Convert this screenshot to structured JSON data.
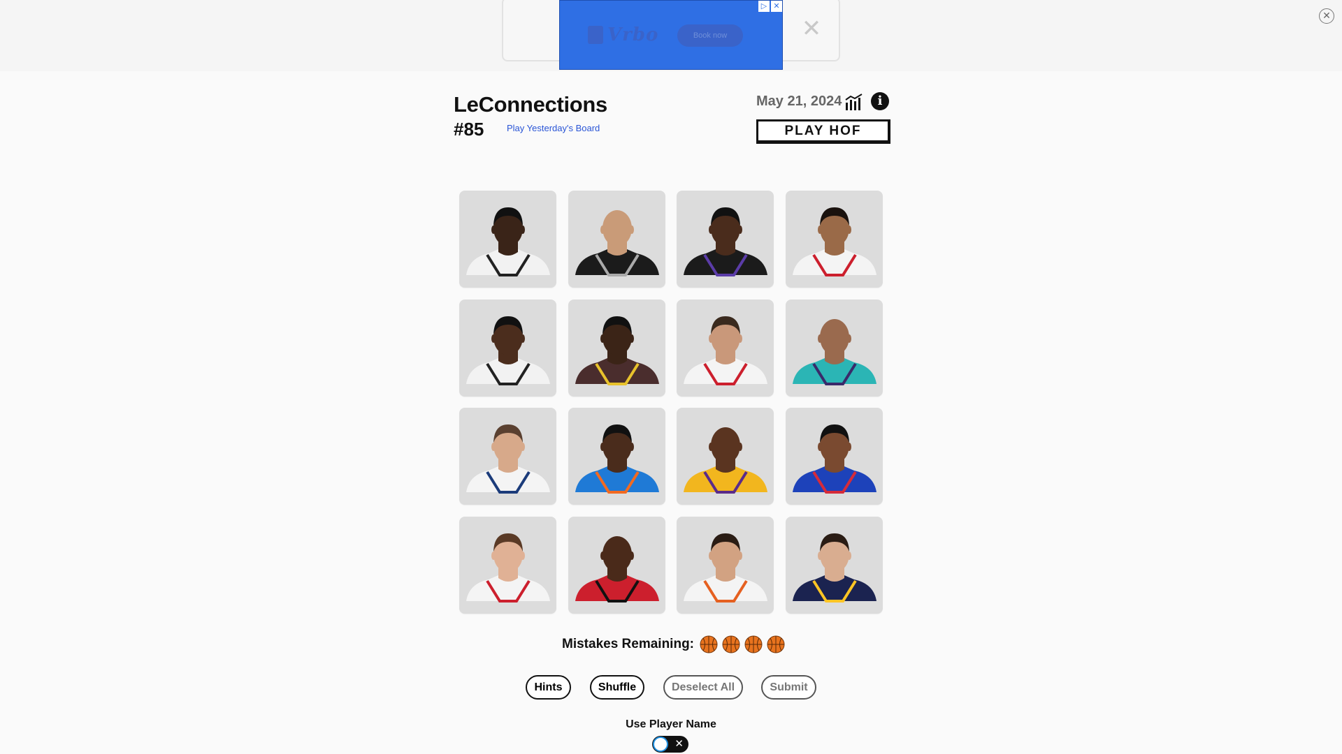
{
  "ad": {
    "brand": "Vrbo",
    "cta": "Book now",
    "adchoices_icon": "adchoices-icon",
    "close_glyph": "✕"
  },
  "page_close_glyph": "✕",
  "header": {
    "title": "LeConnections",
    "puzzle_number": "#85",
    "yesterday_link": "Play Yesterday's Board",
    "date": "May 21, 2024",
    "stats_icon": "bar-chart-icon",
    "info_icon": "info-icon",
    "info_glyph": "i",
    "hof_button": "PLAY HOF"
  },
  "grid": {
    "tiles": [
      {
        "icon": "player-portrait",
        "skin": "#3a2418",
        "hair": "#111",
        "jersey": "#f2f2f2",
        "trim": "#222"
      },
      {
        "icon": "player-portrait",
        "skin": "#c99b78",
        "hair": "none",
        "jersey": "#1b1b1b",
        "trim": "#aaa"
      },
      {
        "icon": "player-portrait",
        "skin": "#4a2c1c",
        "hair": "#111",
        "jersey": "#1b1b1b",
        "trim": "#5b3ca8"
      },
      {
        "icon": "player-portrait",
        "skin": "#9a6a48",
        "hair": "#1a120e",
        "jersey": "#f4f4f4",
        "trim": "#cc1f2d"
      },
      {
        "icon": "player-portrait",
        "skin": "#4b2d1d",
        "hair": "#111",
        "jersey": "#f2f2f2",
        "trim": "#222"
      },
      {
        "icon": "player-portrait",
        "skin": "#3b2417",
        "hair": "#111",
        "jersey": "#4a2d2d",
        "trim": "#e8c22c"
      },
      {
        "icon": "player-portrait",
        "skin": "#c9987a",
        "hair": "#3a2a1e",
        "jersey": "#f4f4f4",
        "trim": "#cc1f2d"
      },
      {
        "icon": "player-portrait",
        "skin": "#9a6a4e",
        "hair": "none",
        "jersey": "#2bb5b5",
        "trim": "#3a2a6a"
      },
      {
        "icon": "player-portrait",
        "skin": "#d7a98a",
        "hair": "#5a4030",
        "jersey": "#f4f4f4",
        "trim": "#1b3b7a"
      },
      {
        "icon": "player-portrait",
        "skin": "#4a2c1c",
        "hair": "#111",
        "jersey": "#1f7ad6",
        "trim": "#f26a21"
      },
      {
        "icon": "player-portrait",
        "skin": "#5a3420",
        "hair": "none",
        "jersey": "#f2b61e",
        "trim": "#5a2b8a"
      },
      {
        "icon": "player-portrait",
        "skin": "#7a4a30",
        "hair": "#111",
        "jersey": "#1d42ba",
        "trim": "#d62b3a"
      },
      {
        "icon": "player-portrait",
        "skin": "#e0b195",
        "hair": "#5a3a26",
        "jersey": "#f4f4f4",
        "trim": "#cc1f2d"
      },
      {
        "icon": "player-portrait",
        "skin": "#4a2a1a",
        "hair": "none",
        "jersey": "#cc1f2d",
        "trim": "#111"
      },
      {
        "icon": "player-portrait",
        "skin": "#d2a282",
        "hair": "#2a1c14",
        "jersey": "#f4f4f4",
        "trim": "#e56020"
      },
      {
        "icon": "player-portrait",
        "skin": "#d9ad90",
        "hair": "#2a1c14",
        "jersey": "#1b2350",
        "trim": "#fec524"
      }
    ]
  },
  "mistakes": {
    "label": "Mistakes Remaining:",
    "remaining": 4,
    "icon": "basketball-icon"
  },
  "actions": {
    "hints": "Hints",
    "shuffle": "Shuffle",
    "deselect": "Deselect All",
    "submit": "Submit"
  },
  "toggle": {
    "label": "Use Player Name",
    "state": "off",
    "off_glyph": "✕"
  }
}
